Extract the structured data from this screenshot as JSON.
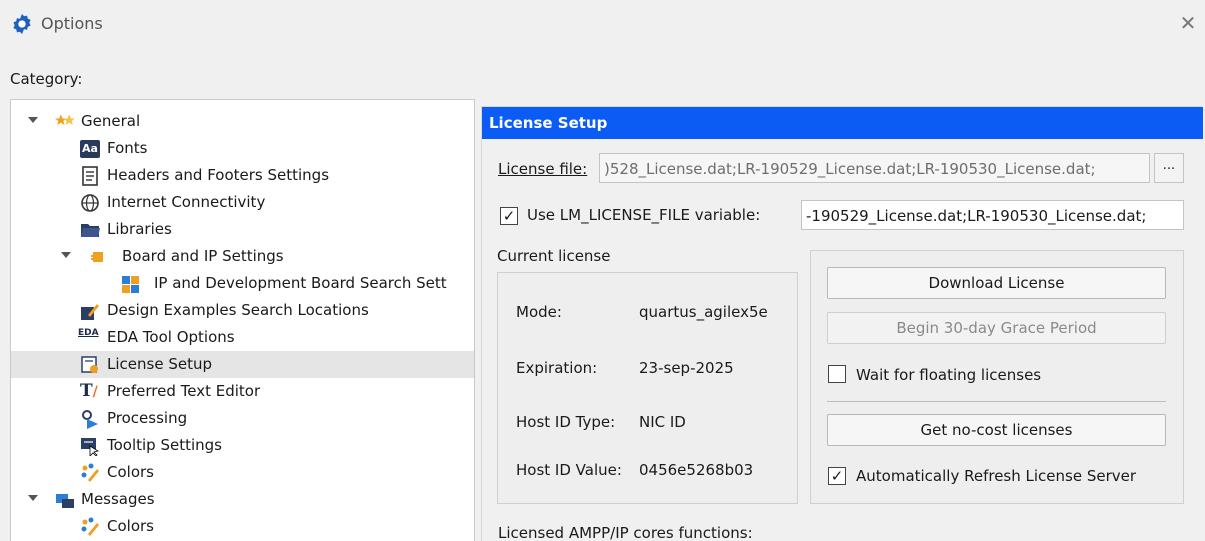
{
  "window": {
    "title": "Options",
    "close_glyph": "✕"
  },
  "category_label": "Category:",
  "tree": {
    "items": [
      {
        "label": "General",
        "icon": "star-icon"
      },
      {
        "label": "Fonts",
        "icon": "font-icon",
        "badge": "Aa"
      },
      {
        "label": "Headers and Footers Settings",
        "icon": "document-icon"
      },
      {
        "label": "Internet Connectivity",
        "icon": "globe-icon"
      },
      {
        "label": "Libraries",
        "icon": "folder-icon"
      },
      {
        "label": "Board and IP Settings",
        "icon": "board-icon"
      },
      {
        "label": "IP and Development Board Search Sett",
        "icon": "puzzle-icon"
      },
      {
        "label": "Design Examples Search Locations",
        "icon": "design-icon"
      },
      {
        "label": "EDA Tool Options",
        "icon": "eda-icon",
        "badge": "EDA"
      },
      {
        "label": "License Setup",
        "icon": "license-icon"
      },
      {
        "label": "Preferred Text Editor",
        "icon": "text-editor-icon",
        "badge": "T"
      },
      {
        "label": "Processing",
        "icon": "processing-icon"
      },
      {
        "label": "Tooltip Settings",
        "icon": "tooltip-icon"
      },
      {
        "label": "Colors",
        "icon": "colors-icon"
      },
      {
        "label": "Messages",
        "icon": "messages-icon"
      },
      {
        "label": "Colors",
        "icon": "colors-icon"
      }
    ]
  },
  "panel": {
    "header": "License Setup",
    "license_file_label": "License file:",
    "license_file_value": ")528_License.dat;LR-190529_License.dat;LR-190530_License.dat;",
    "browse_label": "...",
    "use_lm_label": "Use LM_LICENSE_FILE variable:",
    "use_lm_checked": "✓",
    "lm_value": "-190529_License.dat;LR-190530_License.dat;",
    "current_license_label": "Current license",
    "mode_label": "Mode:",
    "mode_value": "quartus_agilex5e",
    "expiration_label": "Expiration:",
    "expiration_value": "23-sep-2025",
    "hostid_type_label": "Host ID Type:",
    "hostid_type_value": "NIC ID",
    "hostid_value_label": "Host ID Value:",
    "hostid_value": "0456e5268b03",
    "download_button": "Download License",
    "grace_button": "Begin 30-day Grace Period",
    "wait_floating_label": "Wait for floating licenses",
    "no_cost_button": "Get no-cost licenses",
    "auto_refresh_label": "Automatically Refresh License Server",
    "auto_refresh_checked": "✓",
    "ampp_label": "Licensed AMPP/IP cores functions:"
  },
  "colors": {
    "header_blue": "#0a5cf5",
    "selection_gray": "#e5e5e5"
  }
}
